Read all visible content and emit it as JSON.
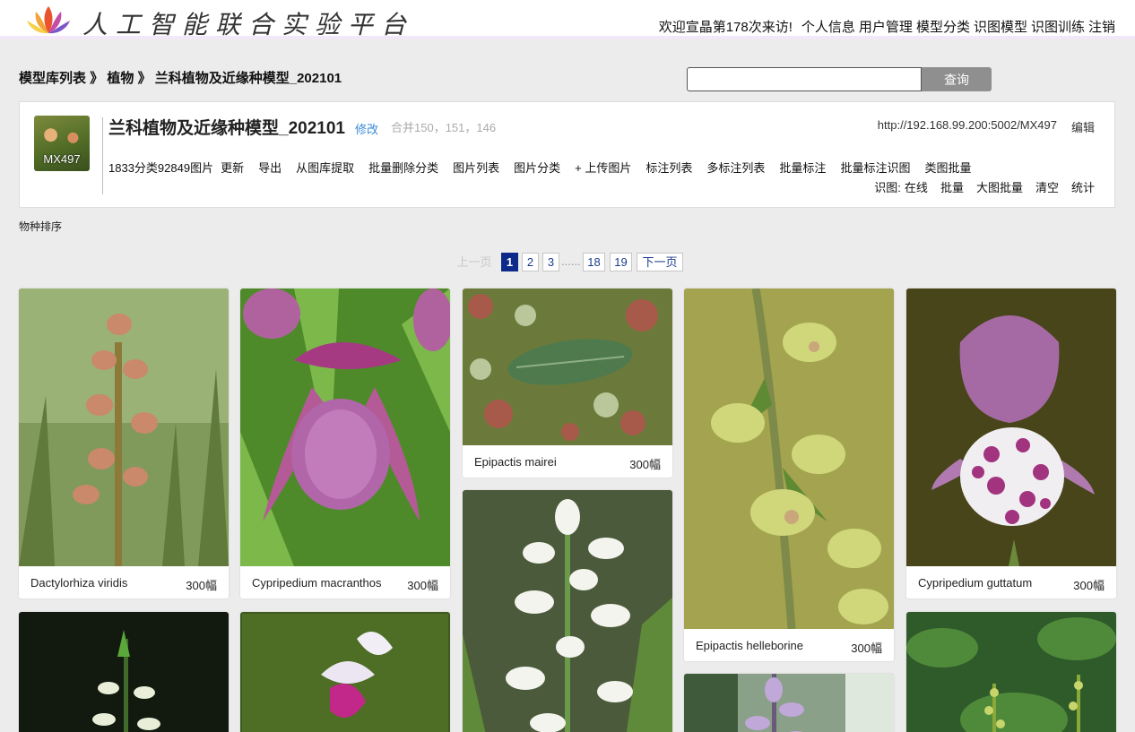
{
  "header": {
    "logo_text": "人工智能联合实验平台",
    "welcome": "欢迎宣晶第178次来访!",
    "nav": [
      "个人信息",
      "用户管理",
      "模型分类",
      "识图模型",
      "识图训练",
      "注销"
    ]
  },
  "breadcrumb": {
    "root": "模型库列表",
    "sep": "》",
    "category": "植物",
    "current": "兰科植物及近缘种模型_202101"
  },
  "search": {
    "value": "",
    "button_label": "查询"
  },
  "model": {
    "thumb_label": "MX497",
    "title": "兰科植物及近缘种模型_202101",
    "edit_label": "修改",
    "merge_text": "合并150，151，146",
    "url": "http://192.168.99.200:5002/MX497",
    "url_edit_label": "编辑",
    "count_text": "1833分类92849图片",
    "actions": [
      "更新",
      "导出",
      "从图库提取",
      "批量删除分类",
      "图片列表",
      "图片分类",
      "+ 上传图片",
      "标注列表",
      "多标注列表",
      "批量标注",
      "批量标注识图",
      "类图批量"
    ],
    "recog_label": "识图:",
    "recog_actions": [
      "在线",
      "批量",
      "大图批量",
      "清空",
      "统计"
    ]
  },
  "sort_label": "物种排序",
  "pagination": {
    "prev": "上一页",
    "pages": [
      "1",
      "2",
      "3"
    ],
    "ellipsis": "......",
    "tail_pages": [
      "18",
      "19"
    ],
    "next": "下一页",
    "current": "1"
  },
  "cards": [
    {
      "name": "Dactylorhiza viridis",
      "count": "300幅"
    },
    {
      "name": "Cypripedium macranthos",
      "count": "300幅"
    },
    {
      "name": "Epipactis mairei",
      "count": "300幅"
    },
    {
      "name": "Epipactis helleborine",
      "count": "300幅"
    },
    {
      "name": "Cypripedium guttatum",
      "count": "300幅"
    }
  ]
}
